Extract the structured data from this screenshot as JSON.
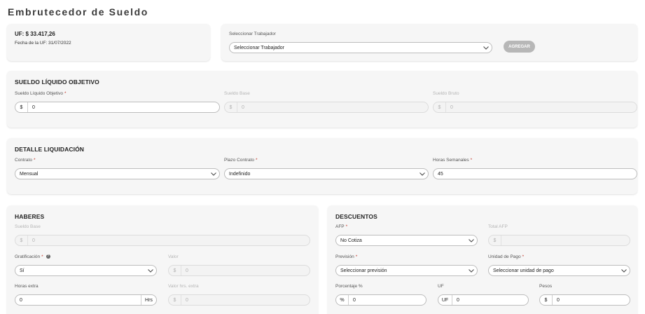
{
  "page": {
    "title": "Embrutecedor de Sueldo"
  },
  "uf": {
    "value": "UF: $ 33.417,26",
    "date": "Fecha de la UF: 31/07/2022"
  },
  "trabajador": {
    "label": "Seleccionar Trabajador",
    "select_value": "Seleccionar Trabajador",
    "add_button": "AGREGAR"
  },
  "sueldo_liquido": {
    "title": "SUELDO LÍQUIDO OBJETIVO",
    "liquido": {
      "label": "Sueldo Líquido Objetivo",
      "prefix": "$",
      "value": "0"
    },
    "base": {
      "label": "Sueldo Base",
      "prefix": "$",
      "value": "0"
    },
    "bruto": {
      "label": "Sueldo Bruto",
      "prefix": "$",
      "value": "0"
    }
  },
  "detalle": {
    "title": "DETALLE LIQUIDACIÓN",
    "contrato": {
      "label": "Contrato",
      "value": "Mensual"
    },
    "plazo": {
      "label": "Plazo Contrato",
      "value": "Indefinido"
    },
    "horas": {
      "label": "Horas Semanales",
      "value": "45"
    }
  },
  "haberes": {
    "title": "HABERES",
    "sueldo_base": {
      "label": "Sueldo Base",
      "prefix": "$",
      "value": "0"
    },
    "gratificacion": {
      "label": "Gratificación",
      "value": "Sí"
    },
    "valor": {
      "label": "Valor",
      "prefix": "$",
      "value": "0"
    },
    "horas_extra": {
      "label": "Horas extra",
      "value": "0",
      "suffix": "Hrs"
    },
    "valor_horas_extra": {
      "label": "Valor hrs. extra",
      "prefix": "$",
      "value": "0"
    }
  },
  "descuentos": {
    "title": "DESCUENTOS",
    "afp": {
      "label": "AFP",
      "value": "No Cotiza"
    },
    "total_afp": {
      "label": "Total AFP",
      "prefix": "$",
      "value": ""
    },
    "prevision": {
      "label": "Previsión",
      "value": "Seleccionar previsión"
    },
    "unidad_pago": {
      "label": "Unidad de Pago",
      "value": "Seleccionar unidad de pago"
    },
    "porcentaje": {
      "label": "Porcentaje %",
      "prefix": "%",
      "value": "0"
    },
    "uf": {
      "label": "UF",
      "prefix": "UF",
      "value": "0"
    },
    "pesos": {
      "label": "Pesos",
      "prefix": "$",
      "value": "0"
    }
  },
  "colors": {
    "card_bg": "#f6f6f6",
    "button_bg": "#b7b7b7",
    "required_mark": "#c0392b"
  },
  "icons": {
    "dropdown": "chevron-down-icon",
    "help": "help-icon"
  }
}
